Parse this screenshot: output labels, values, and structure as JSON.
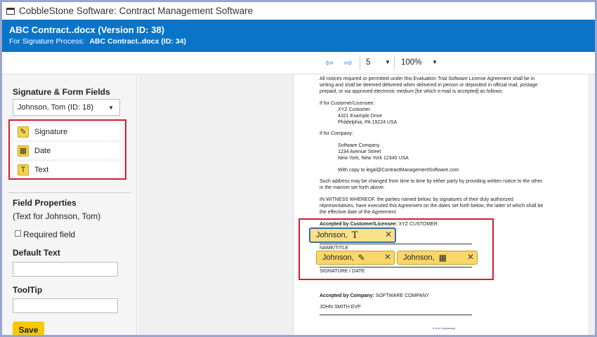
{
  "window": {
    "title": "CobbleStone Software: Contract Management Software"
  },
  "header": {
    "doc_title": "ABC Contract..docx (Version ID: 38)",
    "sub_label": "For Signature Process:",
    "sub_value": "ABC Contract..docx (ID: 34)"
  },
  "toolbar": {
    "page_number": "5",
    "zoom": "100%"
  },
  "sidebar": {
    "heading": "Signature & Form Fields",
    "signer": "Johnson, Tom (ID: 18)",
    "fields": [
      {
        "label": "Signature",
        "icon": "pen-icon"
      },
      {
        "label": "Date",
        "icon": "calendar-icon"
      },
      {
        "label": "Text",
        "icon": "text-cursor-icon"
      }
    ],
    "properties_heading": "Field Properties",
    "properties_sub": "(Text for Johnson, Tom)",
    "required_label": "Required field",
    "default_text_label": "Default Text",
    "tooltip_label": "ToolTip",
    "save_label": "Save"
  },
  "document": {
    "lines": [
      "All notices required or permitted under this Evaluation Trial Software License Agreement shall be in",
      "writing and shall be deemed delivered when delivered in person or deposited in official mail, postage",
      "prepaid, or via approved electronic medium [for which e-mail is accepted] as follows:",
      "If for Customer/Licensee:",
      "XYZ Customer",
      "4321 Example Drive",
      "Phildelphia, PA 19224 USA",
      "If for Company:",
      "Software Company",
      "1234 Avenue Street",
      "New York, New York 12345 USA",
      "With copy to legal@ContractManagementSoftware.com",
      "Such address may be changed from time to time by either party by providing written notice to the other",
      "in the manner set forth above.",
      "IN WITNESS WHEREOF, the parties named below, by signatures of their duly authorized",
      "representatives, have executed this Agreement on the dates set forth below, the latter of which shall be",
      "the effective date of the Agreement."
    ],
    "accepted_customer_label": "Accepted by Customer/Licensee:",
    "accepted_customer_value": "XYZ CUSTOMER",
    "name_title_label": "NAME/TITLE",
    "signature_date_label": "SIGNATURE / DATE",
    "accepted_company_label": "Accepted by Company:",
    "accepted_company_value": "SOFTWARE COMPANY",
    "company_signer": "JOHN SMITH EVP",
    "footer": "5 of 6   Confidential",
    "placed_fields": {
      "text_field": "Johnson,",
      "signature_field": "Johnson,",
      "date_field": "Johnson,"
    }
  }
}
